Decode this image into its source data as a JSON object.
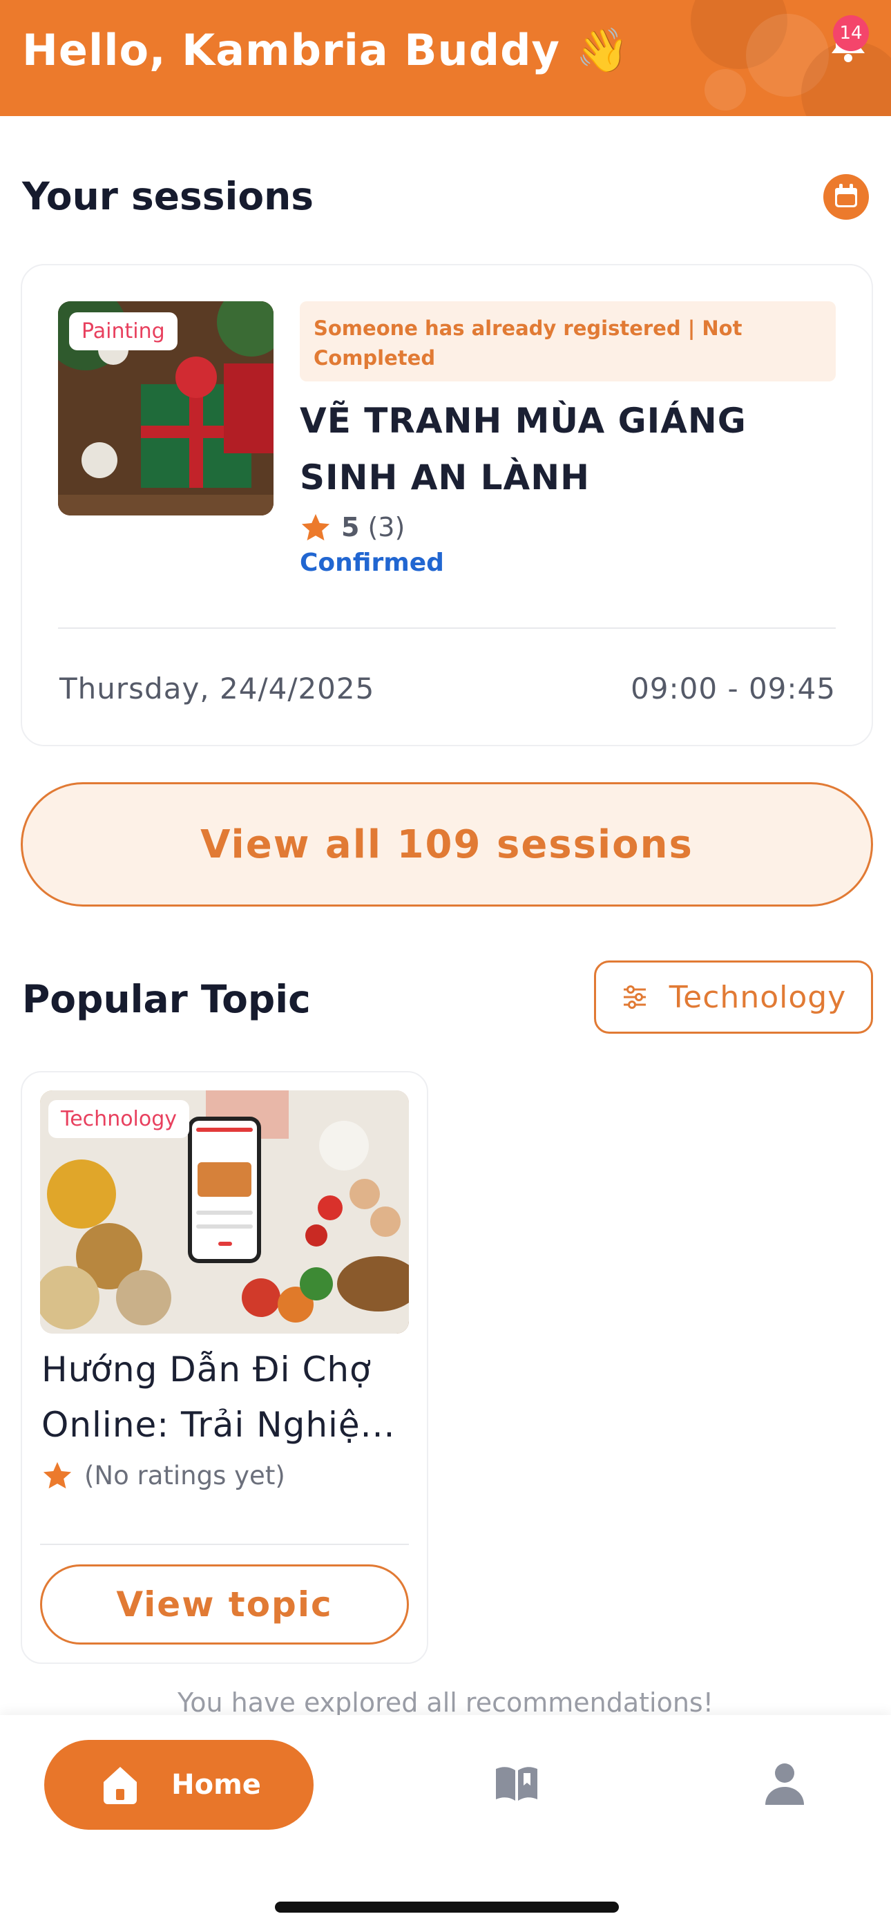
{
  "header": {
    "greeting": "Hello, Kambria Buddy 👋",
    "notification_count": "14",
    "icons": {
      "bell": "bell-icon"
    },
    "colors": {
      "background": "#ec7a2c",
      "badge": "#f4456b"
    }
  },
  "sessions": {
    "section_title": "Your sessions",
    "calendar_icon": "calendar-icon",
    "card": {
      "category_tag": "Painting",
      "status_text": "Someone has already registered | Not Completed",
      "title": "VẼ TRANH MÙA GIÁNG SINH AN LÀNH",
      "rating_score": "5",
      "rating_count": "(3)",
      "confirmation": "Confirmed",
      "date": "Thursday, 24/4/2025",
      "time": "09:00 - 09:45"
    },
    "view_all_label": "View all 109 sessions"
  },
  "popular": {
    "section_title": "Popular Topic",
    "filter_label": "Technology",
    "topic": {
      "category_tag": "Technology",
      "title": "Hướng Dẫn Đi Chợ Online: Trải Nghiệ...",
      "ratings_text": "(No ratings yet)",
      "view_label": "View topic"
    }
  },
  "footer_note": "You have explored all recommendations!",
  "bottom_nav": {
    "home_label": "Home",
    "items": [
      "home-icon",
      "book-icon",
      "profile-icon"
    ]
  },
  "colors": {
    "accent": "#e17a34",
    "link_blue": "#2166d1",
    "tag_text": "#e8405e"
  }
}
